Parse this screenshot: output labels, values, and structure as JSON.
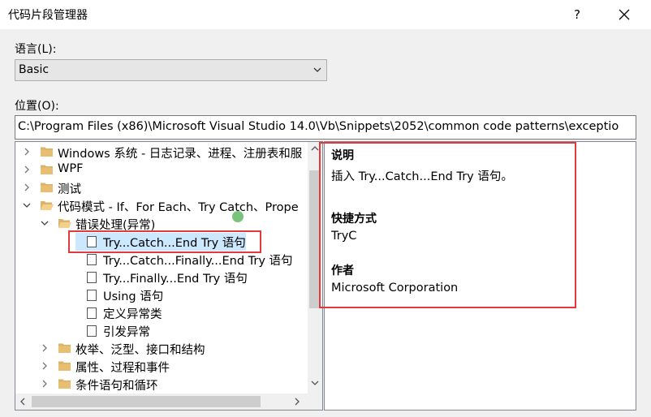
{
  "window": {
    "title": "代码片段管理器",
    "help": "?"
  },
  "language": {
    "label": "语言(L):",
    "value": "Basic"
  },
  "location": {
    "label": "位置(O):",
    "path": "C:\\Program Files (x86)\\Microsoft Visual Studio 14.0\\Vb\\Snippets\\2052\\common code patterns\\exceptio"
  },
  "tree": {
    "items": [
      {
        "label": "Windows 系统 - 日志记录、进程、注册表和服",
        "type": "folder",
        "state": "collapsed"
      },
      {
        "label": "WPF",
        "type": "folder",
        "state": "collapsed"
      },
      {
        "label": "测试",
        "type": "folder",
        "state": "collapsed"
      },
      {
        "label": "代码模式 - If、For Each、Try Catch、Prope",
        "type": "folder",
        "state": "expanded"
      },
      {
        "label": "错误处理(异常)",
        "type": "folder",
        "state": "expanded"
      },
      {
        "label": "Try...Catch...End Try 语句",
        "type": "snippet",
        "selected": true
      },
      {
        "label": "Try...Catch...Finally...End Try 语句",
        "type": "snippet"
      },
      {
        "label": "Try...Finally...End Try 语句",
        "type": "snippet"
      },
      {
        "label": "Using 语句",
        "type": "snippet"
      },
      {
        "label": "定义异常类",
        "type": "snippet"
      },
      {
        "label": "引发异常",
        "type": "snippet"
      },
      {
        "label": "枚举、泛型、接口和结构",
        "type": "folder",
        "state": "collapsed"
      },
      {
        "label": "属性、过程和事件",
        "type": "folder",
        "state": "collapsed"
      },
      {
        "label": "条件语句和循环",
        "type": "folder",
        "state": "collapsed"
      }
    ]
  },
  "details": {
    "description_heading": "说明",
    "description": "插入 Try...Catch...End Try 语句。",
    "shortcut_heading": "快捷方式",
    "shortcut": "TryC",
    "author_heading": "作者",
    "author": "Microsoft Corporation"
  },
  "colors": {
    "folder": "#dcb36b",
    "selection": "#cce8ff",
    "annotation": "#e0393e"
  }
}
